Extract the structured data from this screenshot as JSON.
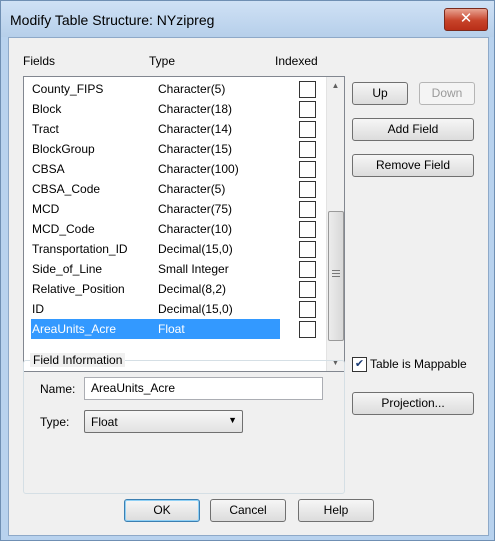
{
  "window": {
    "title": "Modify Table Structure: NYzipreg",
    "close_glyph": "✕"
  },
  "list": {
    "headers": {
      "fields": "Fields",
      "type": "Type",
      "indexed": "Indexed"
    },
    "rows": [
      {
        "name": "County_FIPS",
        "type": "Character(5)",
        "indexed": false,
        "selected": false
      },
      {
        "name": "Block",
        "type": "Character(18)",
        "indexed": false,
        "selected": false
      },
      {
        "name": "Tract",
        "type": "Character(14)",
        "indexed": false,
        "selected": false
      },
      {
        "name": "BlockGroup",
        "type": "Character(15)",
        "indexed": false,
        "selected": false
      },
      {
        "name": "CBSA",
        "type": "Character(100)",
        "indexed": false,
        "selected": false
      },
      {
        "name": "CBSA_Code",
        "type": "Character(5)",
        "indexed": false,
        "selected": false
      },
      {
        "name": "MCD",
        "type": "Character(75)",
        "indexed": false,
        "selected": false
      },
      {
        "name": "MCD_Code",
        "type": "Character(10)",
        "indexed": false,
        "selected": false
      },
      {
        "name": "Transportation_ID",
        "type": "Decimal(15,0)",
        "indexed": false,
        "selected": false
      },
      {
        "name": "Side_of_Line",
        "type": "Small Integer",
        "indexed": false,
        "selected": false
      },
      {
        "name": "Relative_Position",
        "type": "Decimal(8,2)",
        "indexed": false,
        "selected": false
      },
      {
        "name": "ID",
        "type": "Decimal(15,0)",
        "indexed": false,
        "selected": false
      },
      {
        "name": "AreaUnits_Acre",
        "type": "Float",
        "indexed": false,
        "selected": true
      }
    ],
    "scroll_up_glyph": "▲",
    "scroll_down_glyph": "▼"
  },
  "side_buttons": {
    "up": "Up",
    "down": "Down",
    "add_field": "Add Field",
    "remove_field": "Remove Field",
    "projection": "Projection..."
  },
  "mappable": {
    "label": "Table is Mappable",
    "checked": true,
    "check_glyph": "✔"
  },
  "field_info": {
    "title": "Field Information",
    "name_label": "Name:",
    "name_value": "AreaUnits_Acre",
    "type_label": "Type:",
    "type_value": "Float",
    "dropdown_glyph": "▼"
  },
  "footer": {
    "ok": "OK",
    "cancel": "Cancel",
    "help": "Help"
  },
  "colors": {
    "selection": "#3399ff",
    "close": "#c7432a",
    "frame": "#b8d2ee"
  }
}
